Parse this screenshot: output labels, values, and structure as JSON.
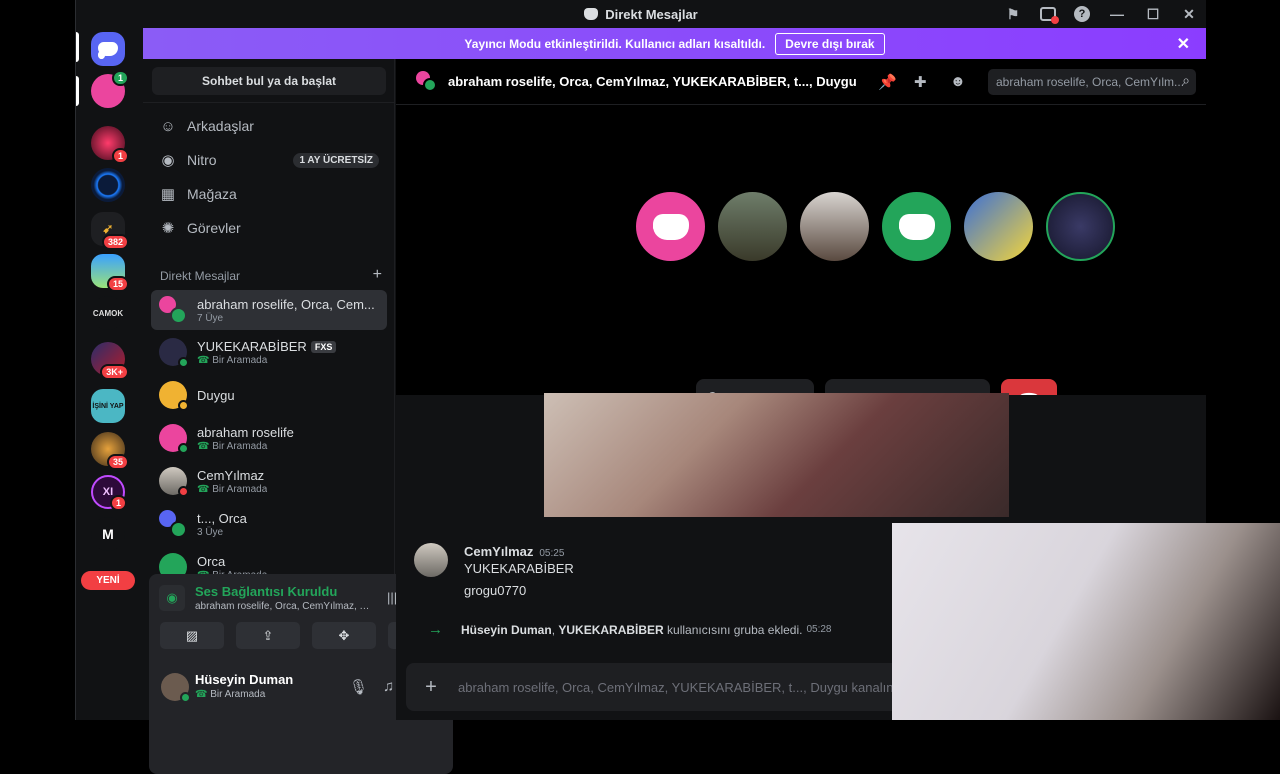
{
  "titlebar": {
    "title": "Direkt Mesajlar",
    "help": "?"
  },
  "banner": {
    "text": "Yayıncı Modu etkinleştirildi. Kullanıcı adları kısaltıldı.",
    "button": "Devre dışı bırak",
    "close": "✕"
  },
  "servers": [
    {
      "name": "home",
      "badge": ""
    },
    {
      "name": "server-2",
      "badge": "1"
    },
    {
      "name": "server-3",
      "badge": ""
    },
    {
      "name": "server-4",
      "badge": "382"
    },
    {
      "name": "server-5",
      "badge": "15"
    },
    {
      "name": "server-6",
      "label": "CAMOK",
      "badge": ""
    },
    {
      "name": "server-7",
      "badge": "3K+"
    },
    {
      "name": "server-8",
      "label": "İŞİNİ YAP",
      "badge": ""
    },
    {
      "name": "server-9",
      "badge": "35"
    },
    {
      "name": "server-10",
      "label": "XI",
      "badge": "1"
    },
    {
      "name": "server-11",
      "label": "M",
      "badge": ""
    }
  ],
  "new_badge": "YENİ",
  "sidebar": {
    "search": "Sohbet bul ya da başlat",
    "nav": [
      {
        "label": "Arkadaşlar",
        "icon": "friends-icon"
      },
      {
        "label": "Nitro",
        "icon": "nitro-icon",
        "badge": "1 AY ÜCRETSİZ"
      },
      {
        "label": "Mağaza",
        "icon": "shop-icon"
      },
      {
        "label": "Görevler",
        "icon": "quests-icon"
      }
    ],
    "dm_header": "Direkt Mesajlar",
    "dm_add": "+",
    "dms": [
      {
        "name": "abraham roselife, Orca, Cem...",
        "sub": "7 Üye"
      },
      {
        "name": "YUKEKARABİBER",
        "tag": "FXS",
        "sub": "Bir Aramada"
      },
      {
        "name": "Duygu",
        "sub": ""
      },
      {
        "name": "abraham roselife",
        "sub": "Bir Aramada"
      },
      {
        "name": "CemYılmaz",
        "sub": "Bir Aramada"
      },
      {
        "name": "t..., Orca",
        "sub": "3 Üye"
      },
      {
        "name": "Orca",
        "sub": "Bir Aramada"
      }
    ]
  },
  "voice": {
    "status": "Ses Bağlantısı Kuruldu",
    "channel": "abraham roselife, Orca, CemYılmaz, Y..."
  },
  "user": {
    "name": "Hüseyin Duman",
    "status": "Bir Aramada"
  },
  "channel": {
    "title": "abraham roselife, Orca, CemYılmaz, YUKEKARABİBER, t..., Duygu",
    "search_placeholder": "abraham roselife, Orca, CemYılm..."
  },
  "messages": {
    "author": "CemYılmaz",
    "time": "05:25",
    "lines": [
      "YUKEKARABİBER",
      "grogu0770"
    ],
    "system": {
      "actor": "Hüseyin Duman",
      "target": "YUKEKARABİBER",
      "text": "kullanıcısını gruba ekledi.",
      "time": "05:28"
    }
  },
  "composer": {
    "placeholder": "abraham roselife, Orca, CemYılmaz, YUKEKARABİBER, t..., Duygu kanalına mesaj gönder"
  },
  "colors": {
    "accent": "#5865f2",
    "banner": "#8b5cf6",
    "online": "#23a55a",
    "danger": "#da373c",
    "pink_avatar": "#eb459e"
  }
}
